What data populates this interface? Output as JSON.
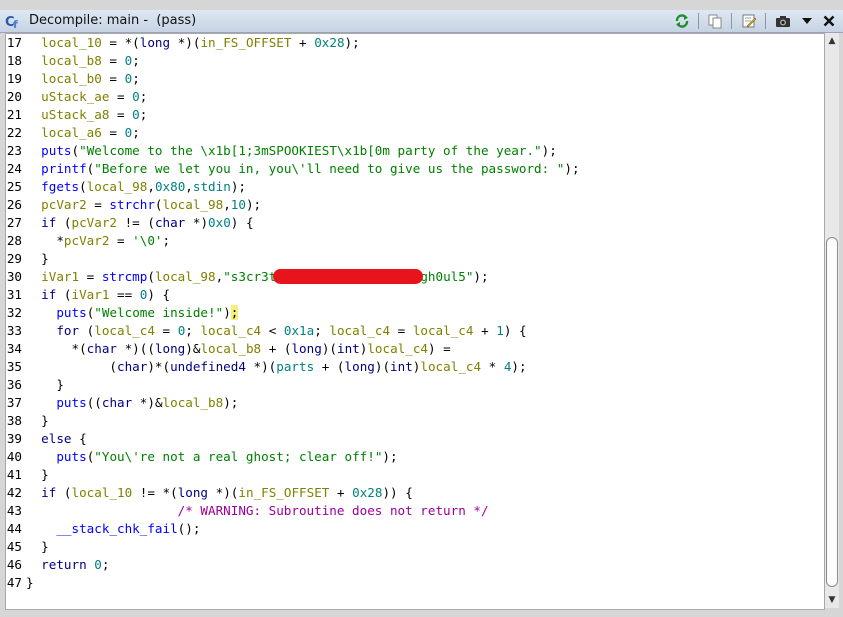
{
  "window": {
    "title": "Decompile: main -  (pass)",
    "icon": "decompile-icon"
  },
  "toolbar": {
    "buttons": [
      {
        "name": "refresh-button",
        "icon": "refresh-icon"
      },
      {
        "name": "copy-button",
        "icon": "copy-icon"
      },
      {
        "name": "edit-signature-button",
        "icon": "edit-icon"
      },
      {
        "name": "snapshot-button",
        "icon": "camera-icon"
      },
      {
        "name": "menu-button",
        "icon": "chevron-down-icon"
      },
      {
        "name": "close-button",
        "icon": "close-icon"
      }
    ]
  },
  "editor": {
    "line_numbers": [
      "17",
      "18",
      "19",
      "20",
      "21",
      "22",
      "23",
      "24",
      "25",
      "26",
      "27",
      "28",
      "29",
      "30",
      "31",
      "32",
      "33",
      "34",
      "35",
      "36",
      "37",
      "38",
      "39",
      "40",
      "41",
      "42",
      "43",
      "44",
      "45",
      "46",
      "47"
    ],
    "lines": [
      [
        [
          "  ",
          ""
        ],
        [
          "local_10",
          "v"
        ],
        [
          " = *(",
          ""
        ],
        [
          "long",
          "k"
        ],
        [
          " *)(",
          ""
        ],
        [
          "in_FS_OFFSET",
          "v"
        ],
        [
          " + ",
          ""
        ],
        [
          "0x28",
          "n"
        ],
        [
          ");",
          ""
        ]
      ],
      [
        [
          "  ",
          ""
        ],
        [
          "local_b8",
          "v"
        ],
        [
          " = ",
          ""
        ],
        [
          "0",
          "n"
        ],
        [
          ";",
          ""
        ]
      ],
      [
        [
          "  ",
          ""
        ],
        [
          "local_b0",
          "v"
        ],
        [
          " = ",
          ""
        ],
        [
          "0",
          "n"
        ],
        [
          ";",
          ""
        ]
      ],
      [
        [
          "  ",
          ""
        ],
        [
          "uStack_ae",
          "v"
        ],
        [
          " = ",
          ""
        ],
        [
          "0",
          "n"
        ],
        [
          ";",
          ""
        ]
      ],
      [
        [
          "  ",
          ""
        ],
        [
          "uStack_a8",
          "v"
        ],
        [
          " = ",
          ""
        ],
        [
          "0",
          "n"
        ],
        [
          ";",
          ""
        ]
      ],
      [
        [
          "  ",
          ""
        ],
        [
          "local_a6",
          "v"
        ],
        [
          " = ",
          ""
        ],
        [
          "0",
          "n"
        ],
        [
          ";",
          ""
        ]
      ],
      [
        [
          "  ",
          ""
        ],
        [
          "puts",
          "f"
        ],
        [
          "(",
          ""
        ],
        [
          "\"Welcome to the \\x1b[1;3mSPOOKIEST\\x1b[0m party of the year.\"",
          "s"
        ],
        [
          ");",
          ""
        ]
      ],
      [
        [
          "  ",
          ""
        ],
        [
          "printf",
          "f"
        ],
        [
          "(",
          ""
        ],
        [
          "\"Before we let you in, you\\'ll need to give us the password: \"",
          "s"
        ],
        [
          ");",
          ""
        ]
      ],
      [
        [
          "  ",
          ""
        ],
        [
          "fgets",
          "f"
        ],
        [
          "(",
          ""
        ],
        [
          "local_98",
          "v"
        ],
        [
          ",",
          ""
        ],
        [
          "0x80",
          "n"
        ],
        [
          ",",
          ""
        ],
        [
          "stdin",
          "n"
        ],
        [
          ");",
          ""
        ]
      ],
      [
        [
          "  ",
          ""
        ],
        [
          "pcVar2",
          "v"
        ],
        [
          " = ",
          ""
        ],
        [
          "strchr",
          "f"
        ],
        [
          "(",
          ""
        ],
        [
          "local_98",
          "v"
        ],
        [
          ",",
          ""
        ],
        [
          "10",
          "n"
        ],
        [
          ");",
          ""
        ]
      ],
      [
        [
          "  ",
          ""
        ],
        [
          "if",
          "k"
        ],
        [
          " (",
          ""
        ],
        [
          "pcVar2",
          "v"
        ],
        [
          " != (",
          ""
        ],
        [
          "char",
          "k"
        ],
        [
          " *)",
          ""
        ],
        [
          "0x0",
          "n"
        ],
        [
          ") {",
          ""
        ]
      ],
      [
        [
          "    *",
          ""
        ],
        [
          "pcVar2",
          "v"
        ],
        [
          " = ",
          ""
        ],
        [
          "'\\0'",
          "s"
        ],
        [
          ";",
          ""
        ]
      ],
      [
        [
          "  }",
          ""
        ]
      ],
      [
        [
          "  ",
          ""
        ],
        [
          "iVar1",
          "v"
        ],
        [
          " = ",
          ""
        ],
        [
          "strcmp",
          "f"
        ],
        [
          "(",
          ""
        ],
        [
          "local_98",
          "v"
        ],
        [
          ",",
          ""
        ],
        [
          "\"s3cr3t",
          "s"
        ],
        [
          "___________________",
          "redact"
        ],
        [
          "gh0ul5\"",
          "s"
        ],
        [
          ");",
          ""
        ]
      ],
      [
        [
          "  ",
          ""
        ],
        [
          "if",
          "k"
        ],
        [
          " (",
          ""
        ],
        [
          "iVar1",
          "v"
        ],
        [
          " == ",
          ""
        ],
        [
          "0",
          "n"
        ],
        [
          ") {",
          ""
        ]
      ],
      [
        [
          "    ",
          ""
        ],
        [
          "puts",
          "f"
        ],
        [
          "(",
          ""
        ],
        [
          "\"Welcome inside!\"",
          "s"
        ],
        [
          ")",
          ""
        ],
        [
          ";",
          "hl"
        ]
      ],
      [
        [
          "    ",
          ""
        ],
        [
          "for",
          "k"
        ],
        [
          " (",
          ""
        ],
        [
          "local_c4",
          "v"
        ],
        [
          " = ",
          ""
        ],
        [
          "0",
          "n"
        ],
        [
          "; ",
          ""
        ],
        [
          "local_c4",
          "v"
        ],
        [
          " < ",
          ""
        ],
        [
          "0x1a",
          "n"
        ],
        [
          "; ",
          ""
        ],
        [
          "local_c4",
          "v"
        ],
        [
          " = ",
          ""
        ],
        [
          "local_c4",
          "v"
        ],
        [
          " + ",
          ""
        ],
        [
          "1",
          "n"
        ],
        [
          ") {",
          ""
        ]
      ],
      [
        [
          "      *(",
          ""
        ],
        [
          "char",
          "k"
        ],
        [
          " *)((",
          ""
        ],
        [
          "long",
          "k"
        ],
        [
          ")&",
          ""
        ],
        [
          "local_b8",
          "v"
        ],
        [
          " + (",
          ""
        ],
        [
          "long",
          "k"
        ],
        [
          ")(",
          ""
        ],
        [
          "int",
          "k"
        ],
        [
          ")",
          ""
        ],
        [
          "local_c4",
          "v"
        ],
        [
          ") =",
          ""
        ]
      ],
      [
        [
          "           (",
          ""
        ],
        [
          "char",
          "k"
        ],
        [
          ")*(",
          ""
        ],
        [
          "undefined4",
          "k"
        ],
        [
          " *)(",
          ""
        ],
        [
          "parts",
          "n"
        ],
        [
          " + (",
          ""
        ],
        [
          "long",
          "k"
        ],
        [
          ")(",
          ""
        ],
        [
          "int",
          "k"
        ],
        [
          ")",
          ""
        ],
        [
          "local_c4",
          "v"
        ],
        [
          " * ",
          ""
        ],
        [
          "4",
          "n"
        ],
        [
          ");",
          ""
        ]
      ],
      [
        [
          "    }",
          ""
        ]
      ],
      [
        [
          "    ",
          ""
        ],
        [
          "puts",
          "f"
        ],
        [
          "((",
          ""
        ],
        [
          "char",
          "k"
        ],
        [
          " *)&",
          ""
        ],
        [
          "local_b8",
          "v"
        ],
        [
          ");",
          ""
        ]
      ],
      [
        [
          "  }",
          ""
        ]
      ],
      [
        [
          "  ",
          ""
        ],
        [
          "else",
          "k"
        ],
        [
          " {",
          ""
        ]
      ],
      [
        [
          "    ",
          ""
        ],
        [
          "puts",
          "f"
        ],
        [
          "(",
          ""
        ],
        [
          "\"You\\'re not a real ghost; clear off!\"",
          "s"
        ],
        [
          ");",
          ""
        ]
      ],
      [
        [
          "  }",
          ""
        ]
      ],
      [
        [
          "  ",
          ""
        ],
        [
          "if",
          "k"
        ],
        [
          " (",
          ""
        ],
        [
          "local_10",
          "v"
        ],
        [
          " != *(",
          ""
        ],
        [
          "long",
          "k"
        ],
        [
          " *)(",
          ""
        ],
        [
          "in_FS_OFFSET",
          "v"
        ],
        [
          " + ",
          ""
        ],
        [
          "0x28",
          "n"
        ],
        [
          ")) {",
          ""
        ]
      ],
      [
        [
          "                    ",
          ""
        ],
        [
          "/* WARNING: Subroutine does not return */",
          "c"
        ]
      ],
      [
        [
          "    ",
          ""
        ],
        [
          "__stack_chk_fail",
          "f"
        ],
        [
          "();",
          ""
        ]
      ],
      [
        [
          "  }",
          ""
        ]
      ],
      [
        [
          "  ",
          ""
        ],
        [
          "return",
          "k"
        ],
        [
          " ",
          ""
        ],
        [
          "0",
          "n"
        ],
        [
          ";",
          ""
        ]
      ],
      [
        [
          "}",
          ""
        ]
      ]
    ]
  },
  "colors": {
    "keyword": "#000080",
    "function": "#0000ff",
    "variable": "#808000",
    "string": "#008000",
    "constant": "#008080",
    "comment": "#9b009b",
    "redaction": "#e8141b"
  }
}
